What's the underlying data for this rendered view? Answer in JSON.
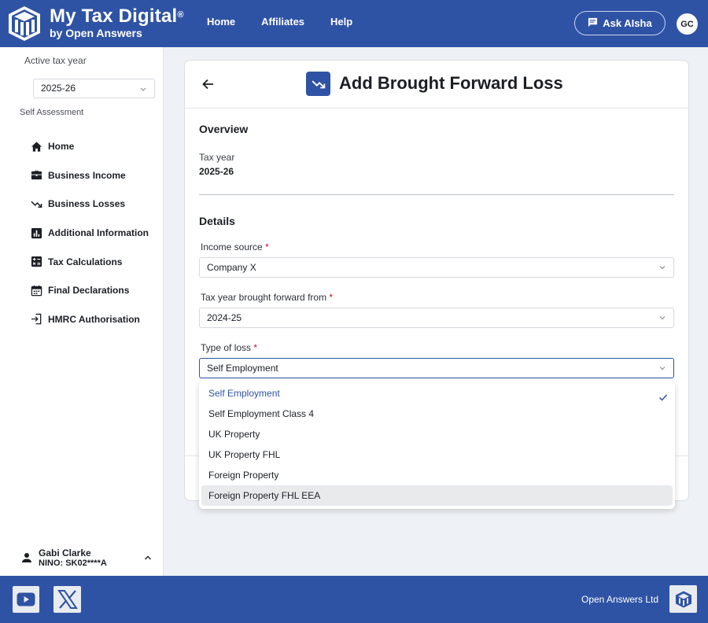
{
  "header": {
    "brand_title": "My Tax Digital",
    "brand_reg": "®",
    "brand_sub": "by Open Answers",
    "nav": [
      {
        "label": "Home"
      },
      {
        "label": "Affiliates"
      },
      {
        "label": "Help"
      }
    ],
    "ask_label": "Ask AIsha",
    "avatar_initials": "GC"
  },
  "sidebar": {
    "active_tax_year_label": "Active tax year",
    "active_tax_year_value": "2025-26",
    "section_label": "Self Assessment",
    "items": [
      {
        "label": "Home",
        "icon": "home-icon"
      },
      {
        "label": "Business Income",
        "icon": "briefcase-icon"
      },
      {
        "label": "Business Losses",
        "icon": "trending-down-icon"
      },
      {
        "label": "Additional Information",
        "icon": "bar-chart-icon"
      },
      {
        "label": "Tax Calculations",
        "icon": "calculator-icon"
      },
      {
        "label": "Final Declarations",
        "icon": "calendar-icon"
      },
      {
        "label": "HMRC Authorisation",
        "icon": "login-icon"
      }
    ],
    "user": {
      "name": "Gabi Clarke",
      "nino": "NINO: SK02****A"
    }
  },
  "card": {
    "title": "Add Brought Forward Loss",
    "overview_heading": "Overview",
    "tax_year_label": "Tax year",
    "tax_year_value": "2025-26",
    "details_heading": "Details",
    "fields": {
      "income_source": {
        "label": "Income source",
        "value": "Company X"
      },
      "tax_year_bf": {
        "label": "Tax year brought forward from",
        "value": "2024-25"
      },
      "type_of_loss": {
        "label": "Type of loss",
        "value": "Self Employment"
      }
    },
    "required_mark": "*"
  },
  "dropdown": {
    "options": [
      {
        "label": "Self Employment"
      },
      {
        "label": "Self Employment Class 4"
      },
      {
        "label": "UK Property"
      },
      {
        "label": "UK Property FHL"
      },
      {
        "label": "Foreign Property"
      },
      {
        "label": "Foreign Property FHL EEA"
      }
    ],
    "selected_index": 0,
    "hover_index": 5
  },
  "footer": {
    "company": "Open Answers Ltd"
  },
  "colors": {
    "brand": "#2f53a4",
    "required": "#c8102e"
  }
}
